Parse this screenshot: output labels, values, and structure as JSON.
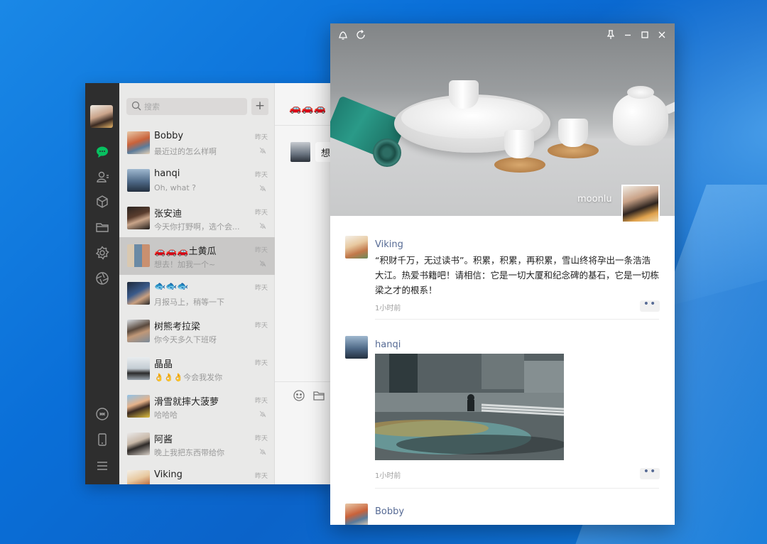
{
  "desktop": {
    "background": "#0b63c9"
  },
  "wechat": {
    "search": {
      "placeholder": "搜索",
      "add_label": "+"
    },
    "chats": [
      {
        "name": "Bobby",
        "preview": "最近过的怎么样啊",
        "time": "昨天"
      },
      {
        "name": "hanqi",
        "preview": "Oh, what ?",
        "time": "昨天"
      },
      {
        "name": "张安迪",
        "preview": "今天你打野啊，选个会...",
        "time": "昨天"
      },
      {
        "name": "🚗🚗🚗土黄瓜",
        "preview": "想去！加我一个~",
        "time": "昨天",
        "selected": true
      },
      {
        "name": "🐟🐟🐟",
        "preview": "月报马上，稍等一下",
        "time": "昨天"
      },
      {
        "name": "树熊考拉梁",
        "preview": "你今天多久下班呀",
        "time": "昨天"
      },
      {
        "name": "晶晶",
        "preview": "👌👌👌今会我发你",
        "time": "昨天"
      },
      {
        "name": "滑雪就摔大菠萝",
        "preview": "哈哈哈",
        "time": "昨天"
      },
      {
        "name": "阿酱",
        "preview": "晚上我把东西带给你",
        "time": "昨天"
      },
      {
        "name": "Viking",
        "preview": "",
        "time": "昨天"
      }
    ],
    "conversation": {
      "title": "🚗🚗🚗",
      "bubble": "想"
    }
  },
  "moments": {
    "owner_name": "moonlu",
    "posts": [
      {
        "author": "Viking",
        "text": "“积财千万，无过读书”。积累，积累，再积累，雪山终将孕出一条浩浩大江。热爱书籍吧！请相信：它是一切大厦和纪念碑的基石，它是一切栋梁之才的根系！",
        "time": "1小时前"
      },
      {
        "author": "hanqi",
        "text": "",
        "time": "1小时前"
      },
      {
        "author": "Bobby",
        "text": "",
        "time": ""
      }
    ],
    "more_label": "••"
  },
  "colors": {
    "accent_green": "#07c160",
    "link_blue": "#576b95",
    "nav_dark": "#2e2e2e"
  }
}
